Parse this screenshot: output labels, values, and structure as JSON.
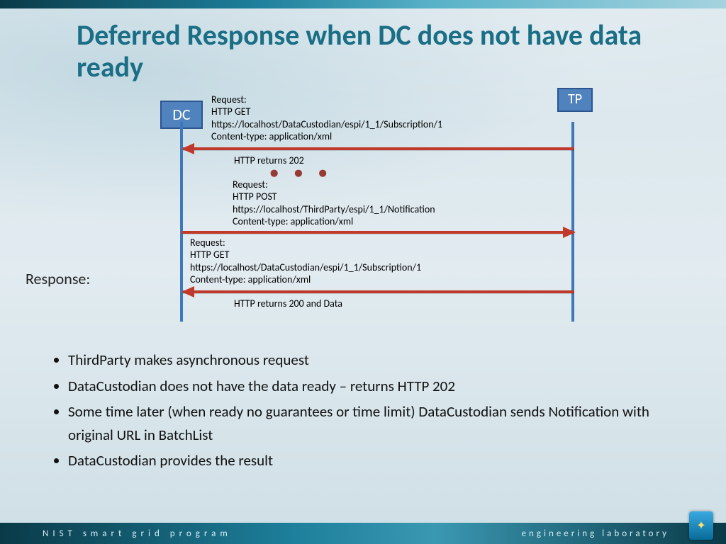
{
  "title": "Deferred Response when DC does not have data ready",
  "nodes": {
    "dc": "DC",
    "tp": "TP"
  },
  "responseLabel": "Response:",
  "messages": {
    "req1": {
      "line1": "Request:",
      "line2": "HTTP GET",
      "line3": "https://localhost/DataCustodian/espi/1_1/Subscription/1",
      "line4": "Content-type: application/xml"
    },
    "ret202": "HTTP returns 202",
    "req2": {
      "line1": "Request:",
      "line2": "HTTP POST",
      "line3": "https://localhost/ThirdParty/espi/1_1/Notification",
      "line4": "Content-type: application/xml"
    },
    "req3": {
      "line1": "Request:",
      "line2": "HTTP GET",
      "line3": "https://localhost/DataCustodian/espi/1_1/Subscription/1",
      "line4": "Content-type: application/xml"
    },
    "ret200": "HTTP returns 200 and Data"
  },
  "bullets": [
    "ThirdParty makes asynchronous request",
    "DataCustodian does not have the data ready – returns HTTP 202",
    "Some time later (when ready no guarantees or time limit) DataCustodian sends Notification with original URL in BatchList",
    "DataCustodian provides the result"
  ],
  "footer": {
    "left": "NIST smart grid program",
    "right": "engineering laboratory"
  }
}
